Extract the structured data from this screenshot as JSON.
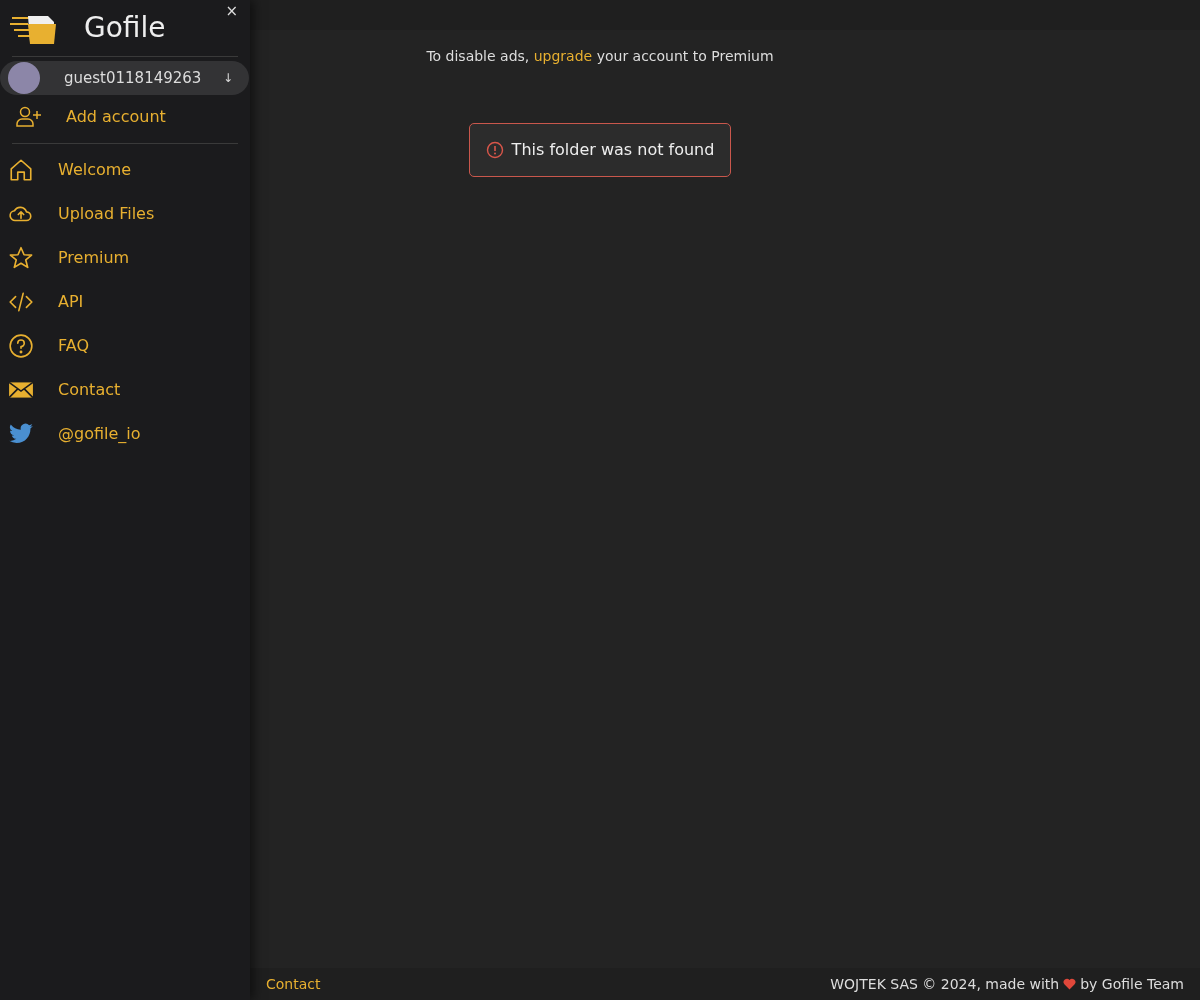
{
  "sidebar": {
    "brand": "Gofile",
    "close": "×",
    "account": {
      "name": "guest0118149263",
      "toggle": "↓"
    },
    "add_account": "Add account",
    "items": [
      {
        "kind": "home",
        "label": "Welcome"
      },
      {
        "kind": "upload",
        "label": "Upload Files"
      },
      {
        "kind": "star",
        "label": "Premium"
      },
      {
        "kind": "code",
        "label": "API"
      },
      {
        "kind": "question",
        "label": "FAQ"
      },
      {
        "kind": "mail",
        "label": "Contact"
      },
      {
        "kind": "bird",
        "label": "@gofile_io"
      }
    ]
  },
  "notice": {
    "before": "To disable ads,",
    "link": "upgrade",
    "after": "your account to Premium"
  },
  "alert": "This folder was not found",
  "footer": {
    "link": "Contact",
    "before": "WOJTEK SAS © 2024, made with",
    "after": "by Gofile Team"
  }
}
